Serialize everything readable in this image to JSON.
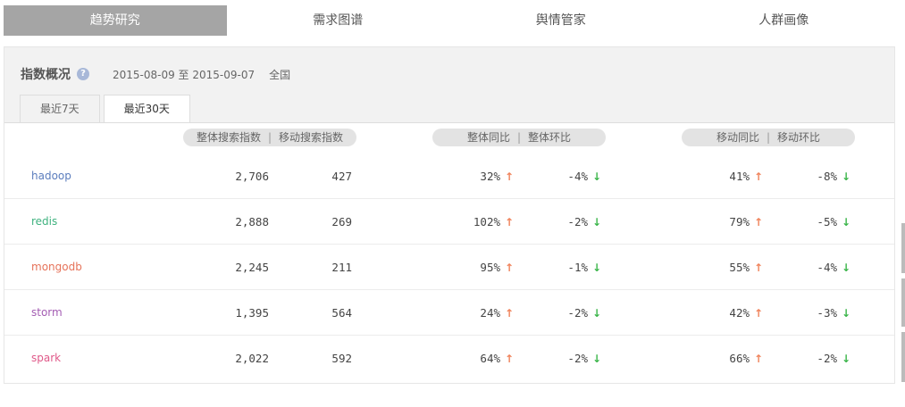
{
  "top_tabs": [
    {
      "label": "趋势研究",
      "active": true
    },
    {
      "label": "需求图谱",
      "active": false
    },
    {
      "label": "舆情管家",
      "active": false
    },
    {
      "label": "人群画像",
      "active": false
    }
  ],
  "overview": {
    "title": "指数概况",
    "help_icon": "question-icon",
    "date_range": "2015-08-09 至 2015-09-07",
    "region": "全国"
  },
  "sub_tabs": [
    {
      "label": "最近7天",
      "active": false
    },
    {
      "label": "最近30天",
      "active": true
    }
  ],
  "header_groups": {
    "index": {
      "a": "整体搜索指数",
      "sep": "|",
      "b": "移动搜索指数"
    },
    "overall": {
      "a": "整体同比",
      "sep": "|",
      "b": "整体环比"
    },
    "mobile": {
      "a": "移动同比",
      "sep": "|",
      "b": "移动环比"
    }
  },
  "arrows": {
    "up": "↑",
    "down": "↓"
  },
  "colors": {
    "up": "#f0825a",
    "down": "#3bb54a"
  },
  "rows": [
    {
      "keyword": "hadoop",
      "color": "#5b7dbd",
      "overall_index": "2,706",
      "mobile_index": "427",
      "overall_yoy": "32%",
      "overall_yoy_dir": "up",
      "overall_mom": "-4%",
      "overall_mom_dir": "down",
      "mobile_yoy": "41%",
      "mobile_yoy_dir": "up",
      "mobile_mom": "-8%",
      "mobile_mom_dir": "down"
    },
    {
      "keyword": "redis",
      "color": "#3fb27f",
      "overall_index": "2,888",
      "mobile_index": "269",
      "overall_yoy": "102%",
      "overall_yoy_dir": "up",
      "overall_mom": "-2%",
      "overall_mom_dir": "down",
      "mobile_yoy": "79%",
      "mobile_yoy_dir": "up",
      "mobile_mom": "-5%",
      "mobile_mom_dir": "down"
    },
    {
      "keyword": "mongodb",
      "color": "#e6735a",
      "overall_index": "2,245",
      "mobile_index": "211",
      "overall_yoy": "95%",
      "overall_yoy_dir": "up",
      "overall_mom": "-1%",
      "overall_mom_dir": "down",
      "mobile_yoy": "55%",
      "mobile_yoy_dir": "up",
      "mobile_mom": "-4%",
      "mobile_mom_dir": "down"
    },
    {
      "keyword": "storm",
      "color": "#a45db3",
      "overall_index": "1,395",
      "mobile_index": "564",
      "overall_yoy": "24%",
      "overall_yoy_dir": "up",
      "overall_mom": "-2%",
      "overall_mom_dir": "down",
      "mobile_yoy": "42%",
      "mobile_yoy_dir": "up",
      "mobile_mom": "-3%",
      "mobile_mom_dir": "down"
    },
    {
      "keyword": "spark",
      "color": "#e05a8a",
      "overall_index": "2,022",
      "mobile_index": "592",
      "overall_yoy": "64%",
      "overall_yoy_dir": "up",
      "overall_mom": "-2%",
      "overall_mom_dir": "down",
      "mobile_yoy": "66%",
      "mobile_yoy_dir": "up",
      "mobile_mom": "-2%",
      "mobile_mom_dir": "down"
    }
  ]
}
